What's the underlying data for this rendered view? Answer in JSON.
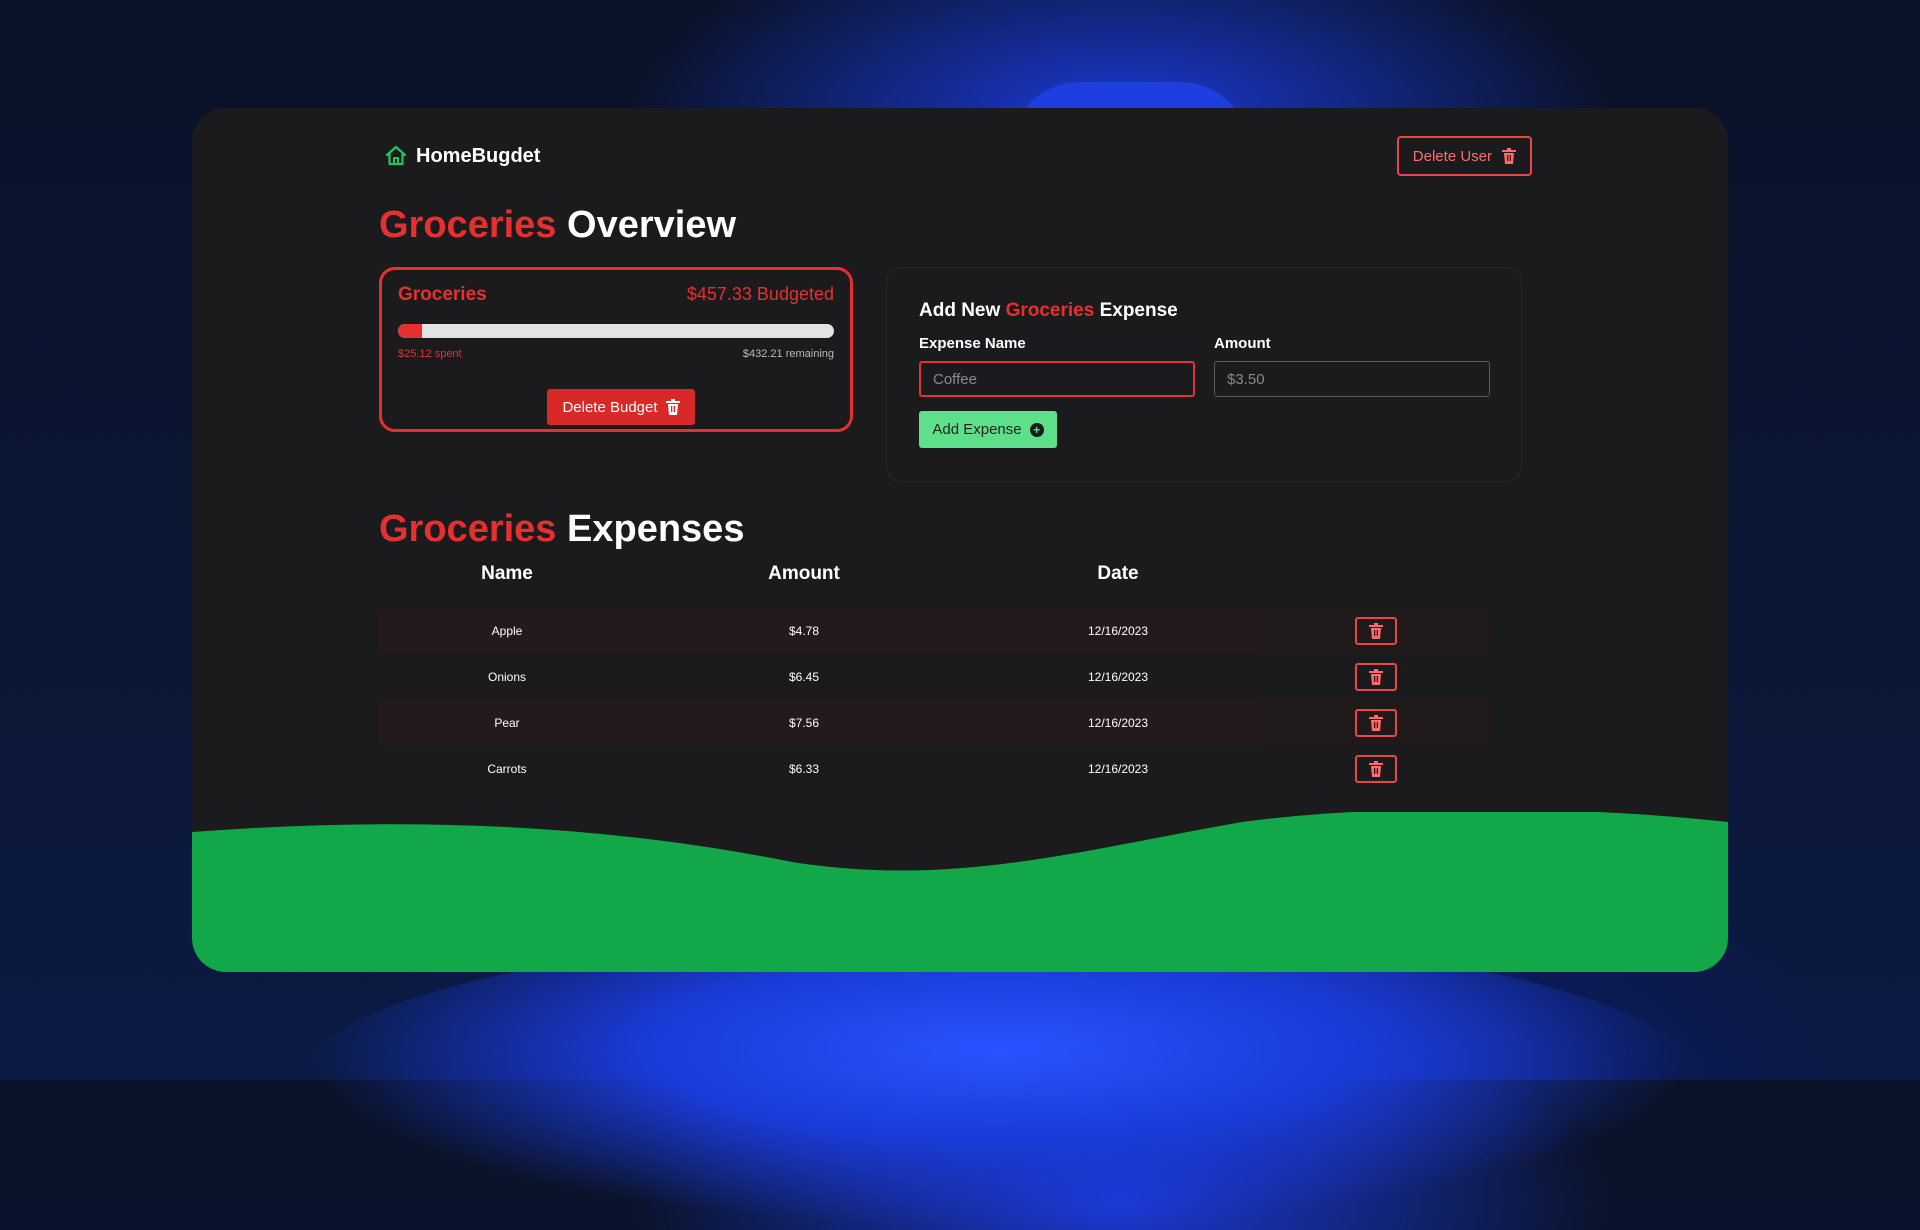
{
  "brand": {
    "name": "HomeBugdet",
    "icon": "home-icon"
  },
  "header": {
    "delete_user_label": "Delete User",
    "delete_icon": "trash-icon"
  },
  "overview": {
    "title_accent": "Groceries",
    "title_rest": "Overview"
  },
  "budget": {
    "name": "Groceries",
    "budgeted_text": "$457.33 Budgeted",
    "spent_text": "$25.12 spent",
    "remaining_text": "$432.21 remaining",
    "progress_fraction": 0.055,
    "delete_label": "Delete Budget"
  },
  "add_expense": {
    "title_prefix": "Add New",
    "title_accent": "Groceries",
    "title_suffix": "Expense",
    "name_label": "Expense Name",
    "name_placeholder": "Coffee",
    "amount_label": "Amount",
    "amount_placeholder": "$3.50",
    "submit_label": "Add Expense"
  },
  "expenses": {
    "title_accent": "Groceries",
    "title_rest": "Expenses",
    "columns": [
      "Name",
      "Amount",
      "Date"
    ],
    "rows": [
      {
        "name": "Apple",
        "amount": "$4.78",
        "date": "12/16/2023"
      },
      {
        "name": "Onions",
        "amount": "$6.45",
        "date": "12/16/2023"
      },
      {
        "name": "Pear",
        "amount": "$7.56",
        "date": "12/16/2023"
      },
      {
        "name": "Carrots",
        "amount": "$6.33",
        "date": "12/16/2023"
      }
    ]
  },
  "colors": {
    "accent_red": "#e53030",
    "accent_green": "#5ee08a",
    "wave_green": "#12a84a",
    "card_bg": "#1b1b1d"
  }
}
